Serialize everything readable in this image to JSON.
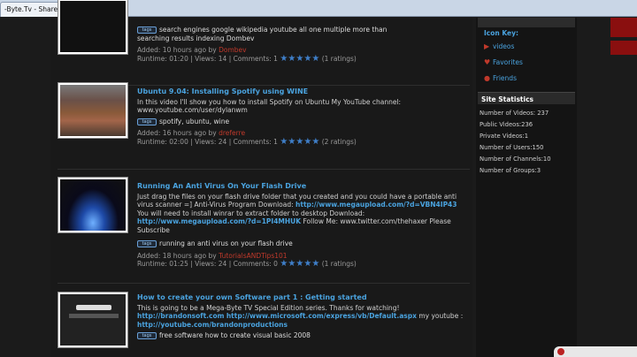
{
  "browser": {
    "tab_title": "-Byte.Tv - Share Your Videos",
    "close_glyph": "×",
    "newtab_glyph": "+"
  },
  "videos": [
    {
      "title": "",
      "description": "",
      "tags_line1": "search engines google wikipedia youtube all one multiple more than",
      "tags_line2": "searching results indexing Dombev",
      "added_prefix": "Added: 10 hours ago by",
      "user": "Dombev",
      "runtime": "Runtime: 01:20 | Views: 14 | Comments: 1",
      "rating": "(1 ratings)"
    },
    {
      "title": "Ubuntu 9.04: Installing Spotify using WINE",
      "description": "In this video I'll show you how to install Spotify on Ubuntu My YouTube channel: www.youtube.com/user/dylanwm",
      "tags": "spotify, ubuntu, wine",
      "added_prefix": "Added: 16 hours ago by",
      "user": "dreferre",
      "runtime": "Runtime: 02:00 | Views: 24 | Comments: 1",
      "rating": "(2 ratings)"
    },
    {
      "title": "Running An Anti Virus On Your Flash Drive",
      "description_a": "Just drag the files on your flash drive folder that you created and you could have a portable anti virus scanner =] Anti-Virus Program Download:",
      "link_a": "http://www.megaupload.com/?d=VBN4IP43",
      "description_b": "You will need to install winrar to extract folder to desktop Download:",
      "link_b": "http://www.megaupload.com/?d=1PI4MHUK",
      "description_c": "Follow Me: www.twitter.com/thehaxer Please Subscribe",
      "tags": "running an anti virus on your flash drive",
      "added_prefix": "Added: 18 hours ago by",
      "user": "TutorialsANDTips101",
      "runtime": "Runtime: 01:25 | Views: 24 | Comments: 0",
      "rating": "(1 ratings)"
    },
    {
      "title": "How to create your own Software part 1 : Getting started",
      "description_a": "This is going to be a Mega-Byte TV Special Edition series. Thanks for watching!",
      "link_a": "http://brandonsoft.com",
      "link_b": "http://www.microsoft.com/express/vb/Default.aspx",
      "description_b": "my youtube :",
      "link_c": "http://youtube.com/brandonproductions",
      "tags": "free software how to create visual basic 2008"
    }
  ],
  "tag_icon_label": "tags",
  "sidebar": {
    "icon_key_title": "Icon Key:",
    "key_items": [
      {
        "icon": "video-icon",
        "glyph": "▶",
        "label": "videos"
      },
      {
        "icon": "heart-icon",
        "glyph": "♥",
        "label": "Favorites"
      },
      {
        "icon": "friends-icon",
        "glyph": "●",
        "label": "Friends"
      }
    ],
    "stats_title": "Site Statistics",
    "stats": [
      "Number of Videos: 237",
      "Public Videos:236",
      "Private Videos:1",
      "Number of Users:150",
      "Number of Channels:10",
      "Number of Groups:3"
    ]
  },
  "colors": {
    "accent": "#4aa3df",
    "user": "#c0392b",
    "star": "#3f7fc9"
  }
}
